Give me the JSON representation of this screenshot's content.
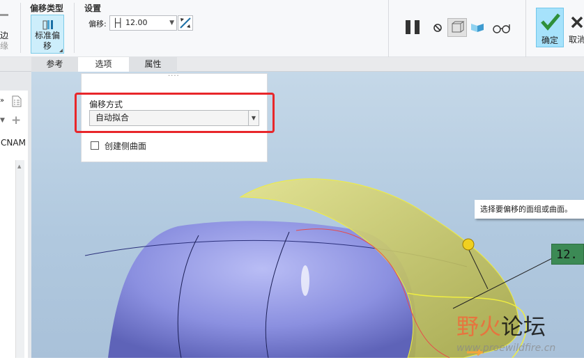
{
  "ribbon": {
    "left_partial_labels": [
      "边",
      "缘"
    ],
    "offset_type": {
      "title": "偏移类型",
      "button_label_line1": "标准偏",
      "button_label_line2": "移"
    },
    "settings": {
      "title": "设置",
      "offset_label": "偏移:",
      "offset_value": "12.00"
    },
    "ok_label": "确定",
    "cancel_label": "取消"
  },
  "tabs": [
    {
      "label": "参考"
    },
    {
      "label": "选项",
      "active": true
    },
    {
      "label": "属性"
    }
  ],
  "options_panel": {
    "grip": "····",
    "method_label": "偏移方式",
    "method_value": "自动拟合",
    "create_side_label": "创建侧曲面",
    "create_side_checked": false
  },
  "left_panel": {
    "column_header": "CNAM"
  },
  "viewport": {
    "tooltip": "选择要偏移的面组或曲面。",
    "dimension_tag": "12.",
    "watermark": "野火论坛",
    "watermark_url": "www.proewildfire.cn"
  },
  "colors": {
    "accent": "#a6e2fb",
    "highlight_box": "#e8262a",
    "dim_tag": "#3c8a55"
  }
}
